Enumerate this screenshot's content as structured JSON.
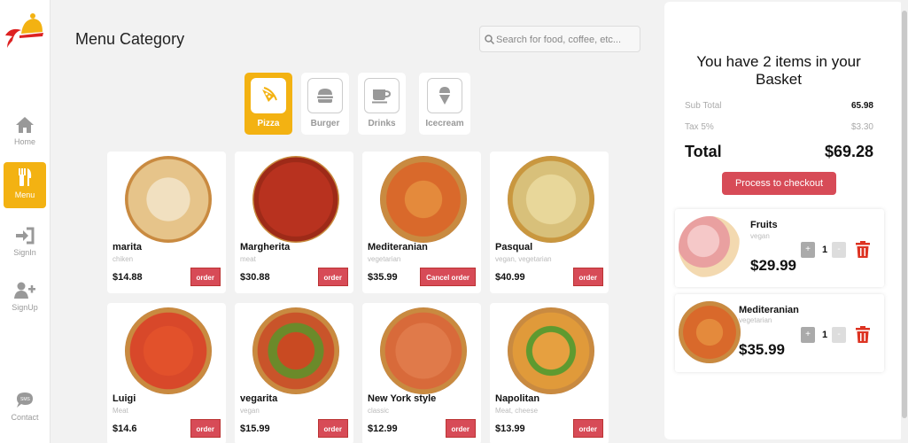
{
  "sidebar": {
    "items": [
      {
        "label": "Home",
        "icon": "home-icon"
      },
      {
        "label": "Menu",
        "icon": "utensils-icon",
        "active": true
      },
      {
        "label": "SignIn",
        "icon": "sign-in-icon"
      },
      {
        "label": "SignUp",
        "icon": "user-plus-icon"
      },
      {
        "label": "Contact",
        "icon": "chat-sms-icon"
      }
    ]
  },
  "main": {
    "title": "Menu Category",
    "search_placeholder": "Search for food, coffee, etc...",
    "categories": [
      {
        "label": "Pizza",
        "icon": "pizza-icon",
        "active": true
      },
      {
        "label": "Burger",
        "icon": "burger-icon"
      },
      {
        "label": "Drinks",
        "icon": "coffee-cup-icon"
      },
      {
        "label": "Icecream",
        "icon": "icecream-icon"
      }
    ],
    "products": [
      {
        "name": "marita",
        "sub": "chiken",
        "price": "$14.88",
        "button": "order"
      },
      {
        "name": "Margherita",
        "sub": "meat",
        "price": "$30.88",
        "button": "order"
      },
      {
        "name": "Mediteranian",
        "sub": "vegetarian",
        "price": "$35.99",
        "button": "Cancel order"
      },
      {
        "name": "Pasqual",
        "sub": "vegan, vegetarian",
        "price": "$40.99",
        "button": "order"
      },
      {
        "name": "Luigi",
        "sub": "Meat",
        "price": "$14.6",
        "button": "order"
      },
      {
        "name": "vegarita",
        "sub": "vegan",
        "price": "$15.99",
        "button": "order"
      },
      {
        "name": "New York style",
        "sub": "classic",
        "price": "$12.99",
        "button": "order"
      },
      {
        "name": "Napolitan",
        "sub": "Meat, cheese",
        "price": "$13.99",
        "button": "order"
      }
    ]
  },
  "basket": {
    "heading": "You have 2 items in your Basket",
    "subtotal_label": "Sub Total",
    "subtotal_value": "65.98",
    "tax_label": "Tax 5%",
    "tax_value": "$3.30",
    "total_label": "Total",
    "total_value": "$69.28",
    "checkout_label": "Process to checkout",
    "items": [
      {
        "name": "Fruits",
        "sub": "vegan",
        "price": "$29.99",
        "qty": "1",
        "plus": "+",
        "minus": "-"
      },
      {
        "name": "Mediteranian",
        "sub": "vegetarian",
        "price": "$35.99",
        "qty": "1",
        "plus": "+",
        "minus": "-"
      }
    ]
  },
  "colors": {
    "accent": "#f3b212",
    "danger": "#d74b57"
  }
}
